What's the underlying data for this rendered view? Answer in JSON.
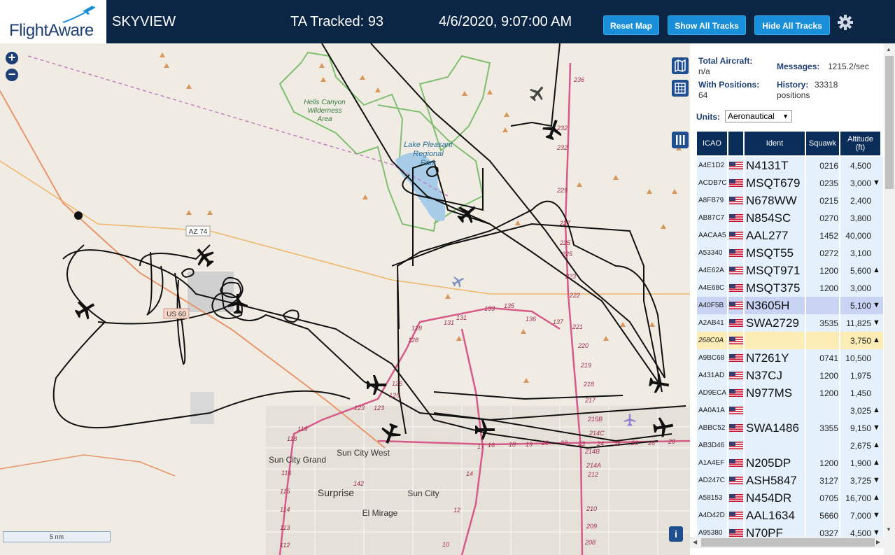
{
  "header": {
    "logo_text": "FlightAware",
    "app_title": "SKYVIEW",
    "tracked": "TA Tracked: 93",
    "datetime": "4/6/2020, 9:07:00 AM",
    "buttons": {
      "reset": "Reset Map",
      "show": "Show All Tracks",
      "hide": "Hide All Tracks"
    }
  },
  "map": {
    "zoom_in": "+",
    "zoom_out": "−",
    "scale_label": "5 nm",
    "info_label": "i",
    "labels": {
      "hells_canyon": [
        "Hells Canyon",
        "Wilderness",
        "Area"
      ],
      "lake_pleasant": [
        "Lake Pleasant",
        "Regional",
        "Park"
      ],
      "az74": "AZ 74",
      "us60": "US 60",
      "sun_city_grand": "Sun City Grand",
      "sun_city_west": "Sun City West",
      "surprise": "Surprise",
      "sun_city": "Sun City",
      "el_mirage": "El Mirage"
    },
    "road_numbers": [
      "236",
      "232",
      "232",
      "229",
      "227",
      "225",
      "225",
      "223",
      "222",
      "221",
      "220",
      "219",
      "218",
      "217",
      "215B",
      "214C",
      "214B",
      "214A",
      "212",
      "210",
      "209",
      "208",
      "128",
      "128",
      "125",
      "125",
      "123",
      "123",
      "131",
      "131",
      "133",
      "135",
      "136",
      "137",
      "119",
      "118",
      "116",
      "115",
      "114",
      "113",
      "112",
      "142",
      "14",
      "12",
      "10",
      "17",
      "16",
      "18",
      "19",
      "20",
      "22",
      "23",
      "24",
      "25",
      "26",
      "26",
      "28"
    ]
  },
  "stats": {
    "total_aircraft_label": "Total Aircraft:",
    "total_aircraft_value": "n/a",
    "with_positions_label": "With Positions:",
    "with_positions_value": "64",
    "messages_label": "Messages:",
    "messages_value": "1215.2/sec",
    "history_label": "History:",
    "history_value": "33318",
    "history_unit": "positions"
  },
  "units": {
    "label": "Units:",
    "selected": "Aeronautical"
  },
  "table": {
    "headers": {
      "icao": "ICAO",
      "ident": "Ident",
      "squawk": "Squawk",
      "altitude": "Altitude",
      "altitude_unit": "(ft)"
    },
    "rows": [
      {
        "icao": "A4E1D2",
        "ident": "N4131T",
        "squawk": "0216",
        "alt": "4,500",
        "trend": ""
      },
      {
        "icao": "ACDB7C",
        "ident": "MSQT679",
        "squawk": "0235",
        "alt": "3,000",
        "trend": "▼"
      },
      {
        "icao": "A8FB79",
        "ident": "N678WW",
        "squawk": "0215",
        "alt": "2,400",
        "trend": ""
      },
      {
        "icao": "AB87C7",
        "ident": "N854SC",
        "squawk": "0270",
        "alt": "3,800",
        "trend": ""
      },
      {
        "icao": "AACAA5",
        "ident": "AAL277",
        "squawk": "1452",
        "alt": "40,000",
        "trend": ""
      },
      {
        "icao": "A53340",
        "ident": "MSQT55",
        "squawk": "0272",
        "alt": "3,100",
        "trend": ""
      },
      {
        "icao": "A4E62A",
        "ident": "MSQT971",
        "squawk": "1200",
        "alt": "5,600",
        "trend": "▲"
      },
      {
        "icao": "A4E68C",
        "ident": "MSQT375",
        "squawk": "1200",
        "alt": "3,000",
        "trend": ""
      },
      {
        "icao": "A40F5B",
        "ident": "N3605H",
        "squawk": "",
        "alt": "5,100",
        "trend": "▼"
      },
      {
        "icao": "A2AB41",
        "ident": "SWA2729",
        "squawk": "3535",
        "alt": "11,825",
        "trend": "▼"
      },
      {
        "icao": "268C0A",
        "ident": "",
        "squawk": "",
        "alt": "3,750",
        "trend": "▲"
      },
      {
        "icao": "A9BC68",
        "ident": "N7261Y",
        "squawk": "0741",
        "alt": "10,500",
        "trend": ""
      },
      {
        "icao": "A431AD",
        "ident": "N37CJ",
        "squawk": "1200",
        "alt": "1,975",
        "trend": ""
      },
      {
        "icao": "AD9ECA",
        "ident": "N977MS",
        "squawk": "1200",
        "alt": "1,450",
        "trend": ""
      },
      {
        "icao": "AA0A1A",
        "ident": "",
        "squawk": "",
        "alt": "3,025",
        "trend": "▲"
      },
      {
        "icao": "ABBC52",
        "ident": "SWA1486",
        "squawk": "3355",
        "alt": "9,150",
        "trend": "▼"
      },
      {
        "icao": "AB3D46",
        "ident": "",
        "squawk": "",
        "alt": "2,675",
        "trend": "▲"
      },
      {
        "icao": "A1A4EF",
        "ident": "N205DP",
        "squawk": "1200",
        "alt": "1,900",
        "trend": "▲"
      },
      {
        "icao": "AD247C",
        "ident": "ASH5847",
        "squawk": "3127",
        "alt": "3,725",
        "trend": "▼"
      },
      {
        "icao": "A58153",
        "ident": "N454DR",
        "squawk": "0705",
        "alt": "16,700",
        "trend": "▲"
      },
      {
        "icao": "A4D42D",
        "ident": "AAL1634",
        "squawk": "5660",
        "alt": "7,000",
        "trend": "▼"
      },
      {
        "icao": "A95380",
        "ident": "N70PF",
        "squawk": "0327",
        "alt": "4,500",
        "trend": "▼"
      }
    ]
  },
  "colors": {
    "header_bg": "#0b2545",
    "button": "#1a8fd9",
    "table_header": "#0b2d5a",
    "row_bg": "#e4f0fb",
    "row_selected": "#c9d4f5",
    "row_highlight": "#fbedb5",
    "interstate": "#d65a8a",
    "track": "#111111"
  }
}
